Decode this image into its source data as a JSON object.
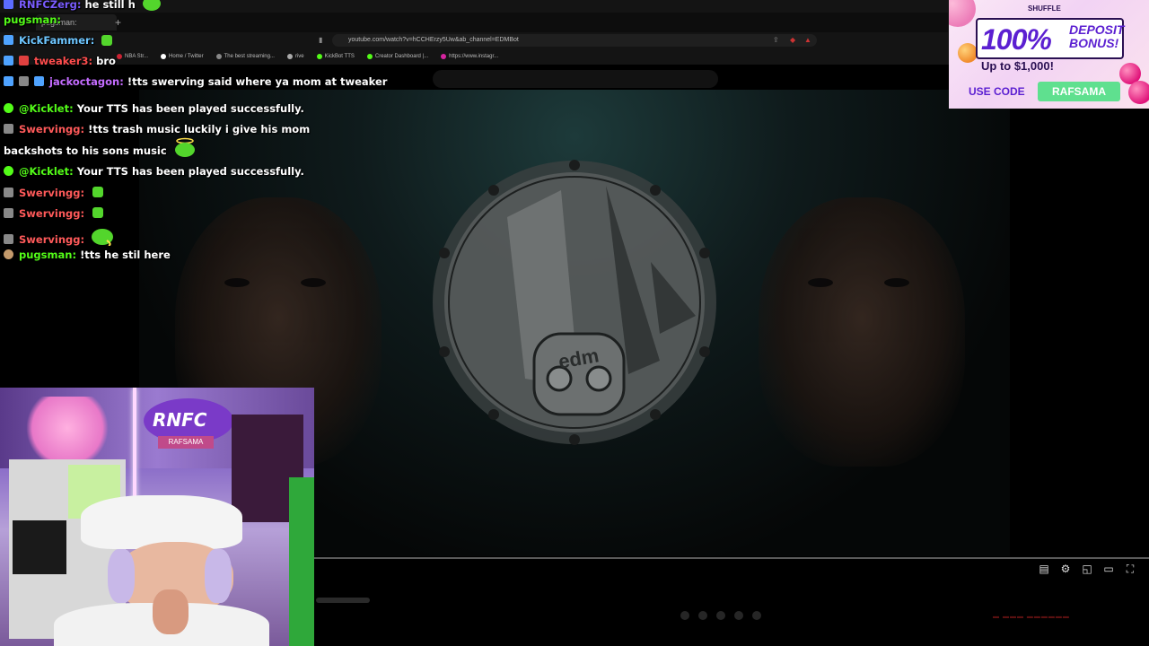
{
  "browser": {
    "tab_label": "pugsman:",
    "address": "youtube.com/watch?v=hCCHErzy5Uw&ab_channel=EDMBot",
    "bookmarks": [
      {
        "label": "NBA Str...",
        "color": "#c23"
      },
      {
        "label": "Home / Twitter",
        "color": "#fff"
      },
      {
        "label": "The best streaming...",
        "color": "#888"
      },
      {
        "label": "rive",
        "color": "#aaa"
      },
      {
        "label": "KickBot TTS",
        "color": "#53fc18"
      },
      {
        "label": "Creator Dashboard |...",
        "color": "#53fc18"
      },
      {
        "label": "https://www.instagr...",
        "color": "#d6249f"
      }
    ]
  },
  "chat": {
    "messages": [
      {
        "user": "RNFCZerg:",
        "text": "he still h",
        "user_color": "#7a5cff"
      },
      {
        "user": "pugsman:",
        "text": "",
        "user_color": "#53fc18"
      },
      {
        "user": "KickFammer:",
        "text": "",
        "user_color": "#6ec6ff"
      },
      {
        "user": "tweaker3:",
        "text": "bro",
        "user_color": "#ff4d4d"
      },
      {
        "user": "jackoctagon:",
        "text": "!tts swerving said where ya mom at tweaker",
        "user_color": "#c46cff"
      },
      {
        "user": "@Kicklet:",
        "text": "Your TTS has been played successfully.",
        "user_color": "#53fc18"
      },
      {
        "user": "Swervingg:",
        "text": "!tts trash music luckily i give his mom backshots to his sons music",
        "user_color": "#ff5a5a"
      },
      {
        "user": "@Kicklet:",
        "text": "Your TTS has been played successfully.",
        "user_color": "#53fc18"
      },
      {
        "user": "Swervingg:",
        "text": "",
        "user_color": "#ff5a5a"
      },
      {
        "user": "Swervingg:",
        "text": "",
        "user_color": "#ff5a5a"
      },
      {
        "user": "Swervingg:",
        "text": "",
        "user_color": "#ff5a5a"
      },
      {
        "user": "pugsman:",
        "text": "!tts he stil here",
        "user_color": "#53fc18"
      }
    ]
  },
  "video": {
    "logo_text": "edm",
    "controls": [
      "subtitles-icon",
      "settings-icon",
      "miniplayer-icon",
      "theater-icon",
      "fullscreen-icon"
    ]
  },
  "ad": {
    "brand": "SHUFFLE",
    "percent": "100%",
    "headline": "DEPOSIT BONUS!",
    "offer": "Up to $1,000!",
    "use_code": "USE CODE",
    "code": "RAFSAMA"
  },
  "webcam": {
    "sign_text": "RNFC",
    "sign_sub": "RAFSAMA"
  }
}
